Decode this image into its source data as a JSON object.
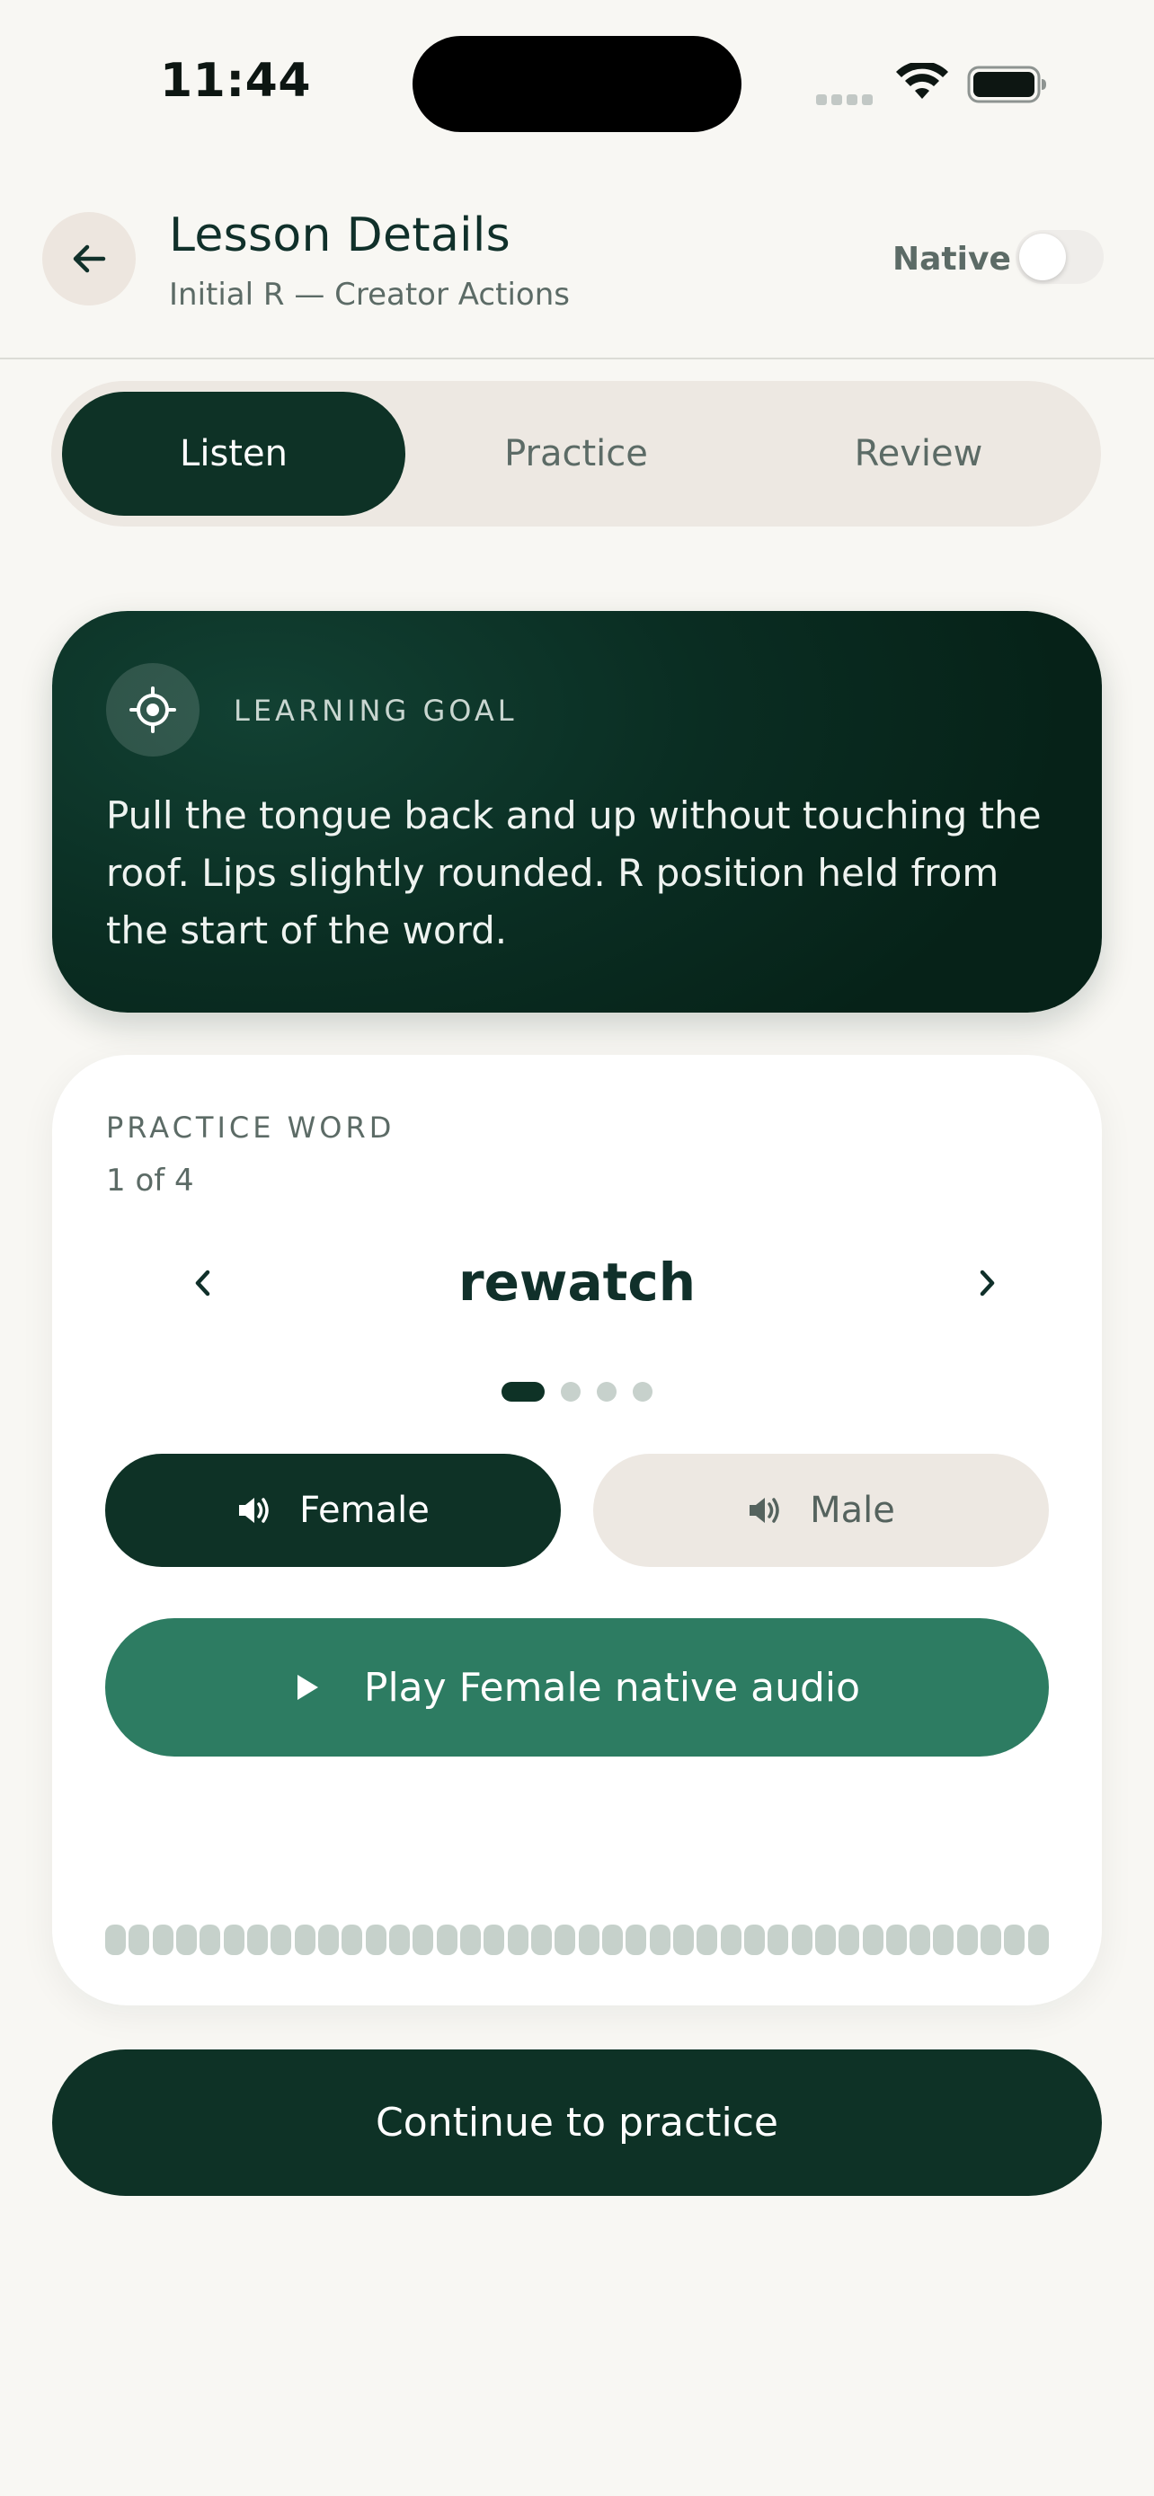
{
  "status_bar": {
    "time": "11:44"
  },
  "header": {
    "back_icon": "arrow-left-icon",
    "title": "Lesson Details",
    "subtitle": "Initial R — Creator Actions",
    "native_label": "Native",
    "native_toggle_on": false
  },
  "tabs": [
    {
      "label": "Listen",
      "active": true
    },
    {
      "label": "Practice",
      "active": false
    },
    {
      "label": "Review",
      "active": false
    }
  ],
  "goal": {
    "icon": "target-icon",
    "heading": "LEARNING GOAL",
    "text": "Pull the tongue back and up without touching the roof. Lips slightly rounded. R position held from the start of the word."
  },
  "practice": {
    "label": "PRACTICE WORD",
    "counter": "1 of 4",
    "word": "rewatch",
    "current_index": 1,
    "total": 4,
    "voices": [
      {
        "label": "Female",
        "icon": "speaker-icon",
        "selected": true
      },
      {
        "label": "Male",
        "icon": "speaker-icon",
        "selected": false
      }
    ],
    "play_label": "Play Female native audio"
  },
  "continue_label": "Continue to practice",
  "colors": {
    "background": "#f8f7f3",
    "primary_dark": "#0e3226",
    "accent_green": "#2d7c62",
    "muted_surface": "#ede8e2",
    "muted_text": "#5c6b66"
  }
}
